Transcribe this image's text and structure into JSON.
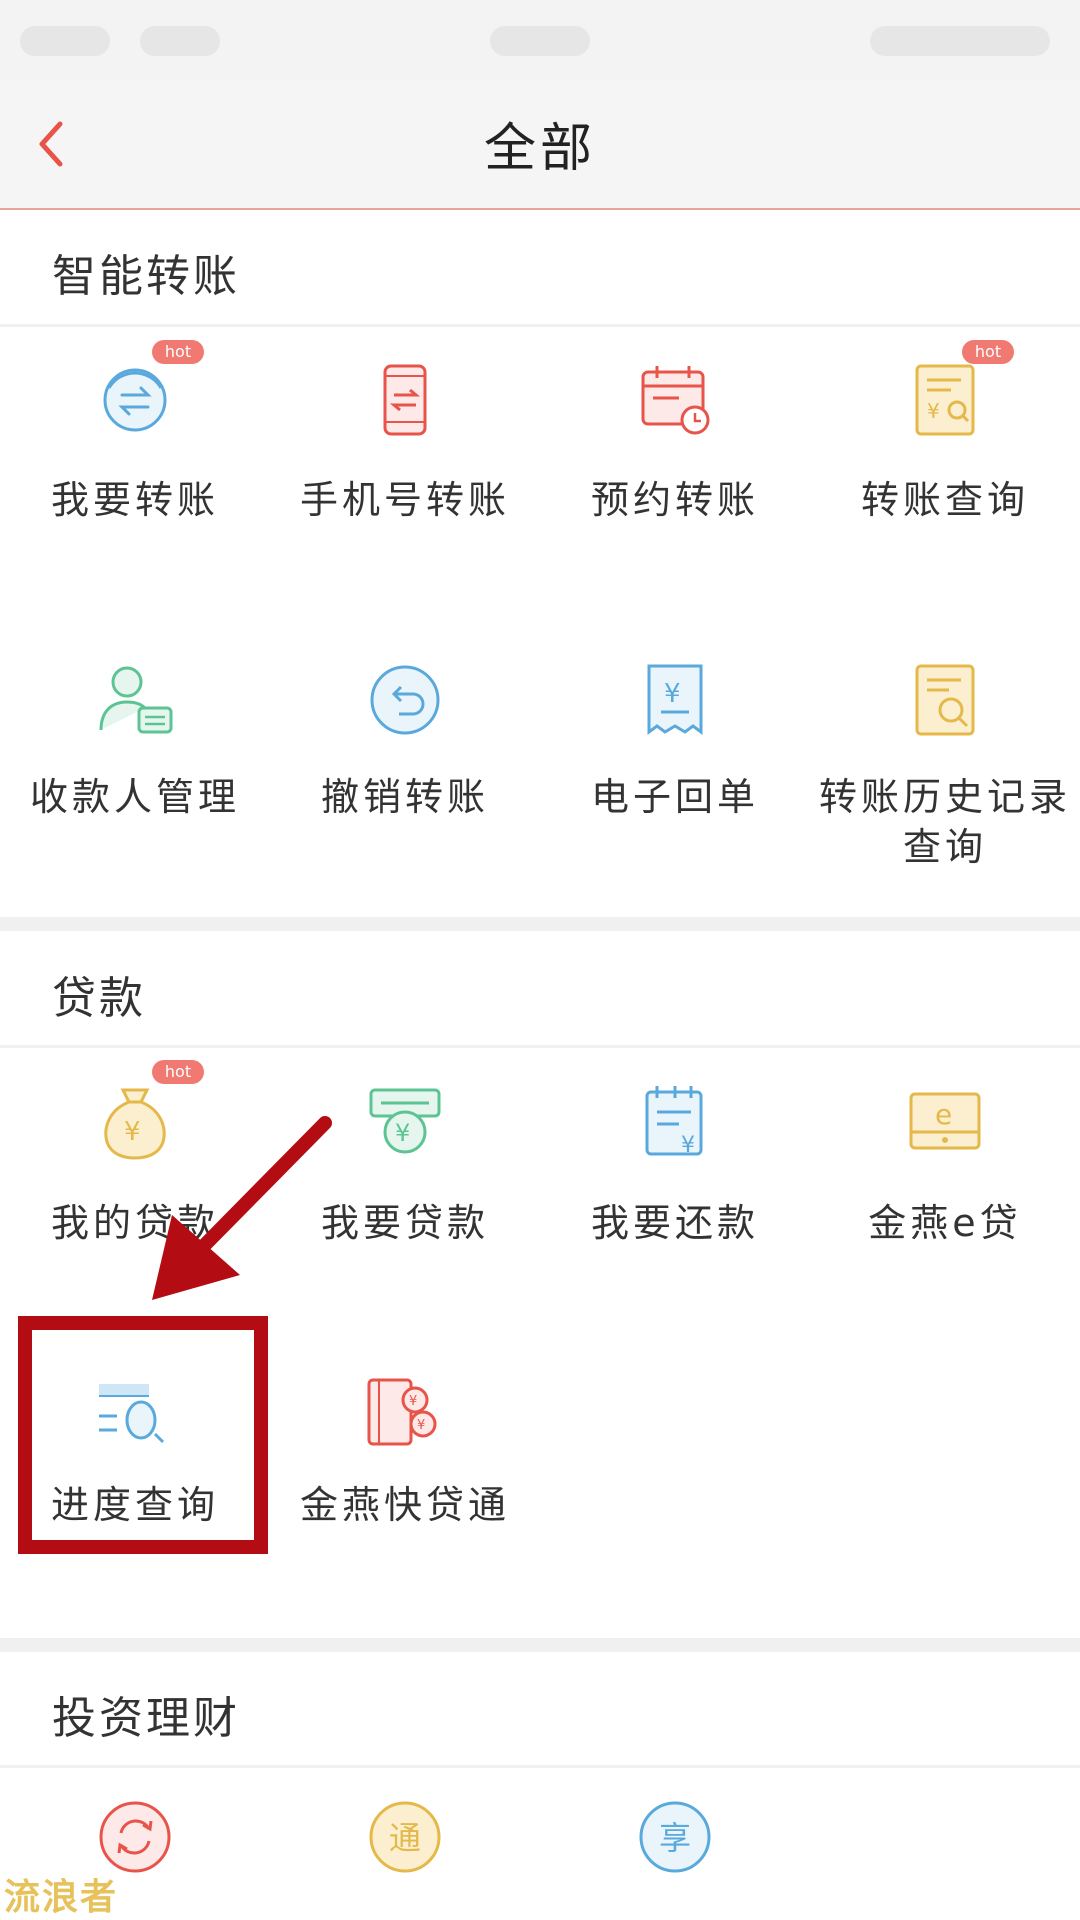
{
  "header": {
    "title": "全部"
  },
  "sections": [
    {
      "title": "智能转账",
      "items": [
        {
          "label": "我要转账",
          "hot": "hot"
        },
        {
          "label": "手机号转账"
        },
        {
          "label": "预约转账"
        },
        {
          "label": "转账查询",
          "hot": "hot"
        },
        {
          "label": "收款人管理"
        },
        {
          "label": "撤销转账"
        },
        {
          "label": "电子回单"
        },
        {
          "label": "转账历史记录",
          "label_line2": "查询"
        }
      ]
    },
    {
      "title": "贷款",
      "items": [
        {
          "label": "我的贷款",
          "hot": "hot"
        },
        {
          "label": "我要贷款"
        },
        {
          "label": "我要还款"
        },
        {
          "label": "金燕e贷"
        },
        {
          "label": "进度查询"
        },
        {
          "label": "金燕快贷通"
        }
      ]
    },
    {
      "title": "投资理财",
      "icons": {
        "item2_glyph": "通",
        "item3_glyph": "享"
      }
    }
  ],
  "icon_names": [
    "transfer-icon",
    "phone-transfer-icon",
    "calendar-clock-icon",
    "receipt-search-icon",
    "payee-icon",
    "undo-icon",
    "receipt-yen-icon",
    "history-search-icon",
    "money-bag-icon",
    "cash-machine-icon",
    "repay-doc-icon",
    "e-loan-icon",
    "progress-search-icon",
    "coin-card-icon",
    "refresh-icon",
    "tong-icon",
    "xiang-icon"
  ],
  "colors": {
    "accent": "#e8544a",
    "hot_badge": "#f07a72",
    "highlight": "#b30c12",
    "watermark": "#e7c25a"
  },
  "watermark": "流浪者"
}
